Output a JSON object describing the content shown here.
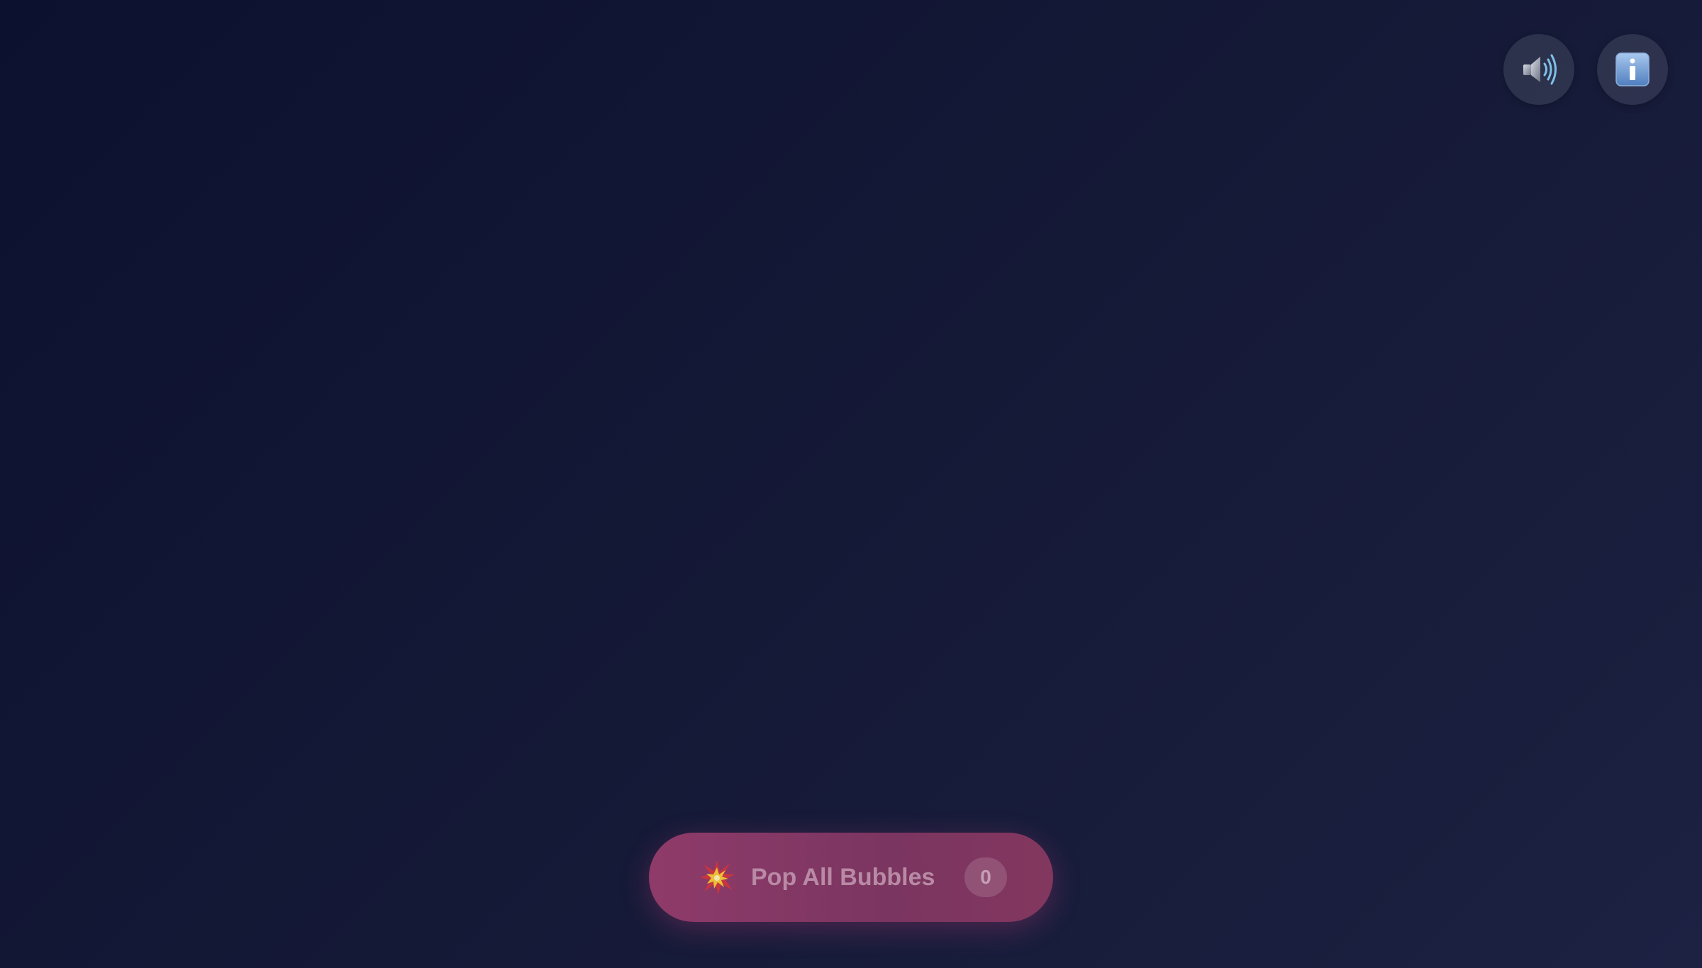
{
  "toolbar": {
    "sound_icon": "speaker-high-volume-icon",
    "info_icon": "info-icon"
  },
  "pop_button": {
    "icon": "collision-burst-icon",
    "label": "Pop All Bubbles",
    "count": "0"
  },
  "colors": {
    "background_start": "#0c1130",
    "background_end": "#1d2142",
    "button_accent": "#8f3b6a"
  }
}
